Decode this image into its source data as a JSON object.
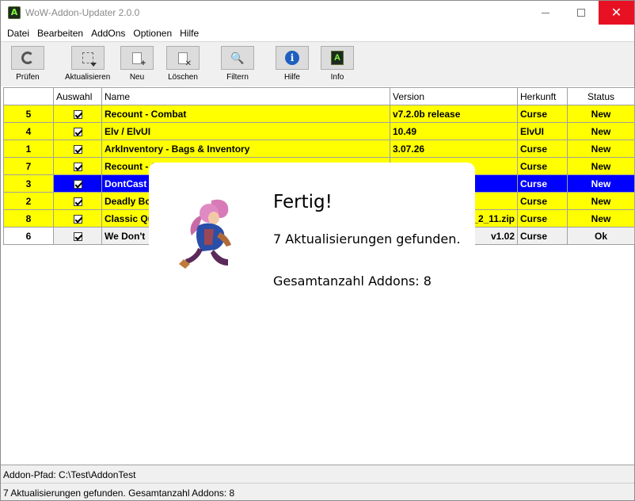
{
  "window": {
    "title": "WoW-Addon-Updater 2.0.0",
    "icon_letter": "A",
    "close_glyph": "✕"
  },
  "menu": [
    "Datei",
    "Bearbeiten",
    "AddOns",
    "Optionen",
    "Hilfe"
  ],
  "toolbar": {
    "check": "Prüfen",
    "update": "Aktualisieren",
    "new": "Neu",
    "delete": "Löschen",
    "filter": "Filtern",
    "help": "Hilfe",
    "info": "Info"
  },
  "grid": {
    "headers": [
      "",
      "Auswahl",
      "Name",
      "Version",
      "Herkunft",
      "Status"
    ],
    "rows": [
      {
        "num": "5",
        "name": "Recount - Combat",
        "version": "v7.2.0b release",
        "origin": "Curse",
        "status": "New"
      },
      {
        "num": "4",
        "name": "Elv / ElvUI",
        "version": "10.49",
        "origin": "ElvUI",
        "status": "New"
      },
      {
        "num": "1",
        "name": "ArkInventory - Bags & Inventory",
        "version": "3.07.26",
        "origin": "Curse",
        "status": "New"
      },
      {
        "num": "7",
        "name": "Recount - Co",
        "version": "",
        "origin": "Curse",
        "status": "New"
      },
      {
        "num": "3",
        "name": "DontCast -",
        "version": "",
        "origin": "Curse",
        "status": "New"
      },
      {
        "num": "2",
        "name": "Deadly Bo",
        "version": "",
        "origin": "Curse",
        "status": "New"
      },
      {
        "num": "8",
        "name": "Classic Qu",
        "version": "_2_11.zip",
        "origin": "Curse",
        "status": "New"
      },
      {
        "num": "6",
        "name": "We Don't",
        "version": "v1.02",
        "origin": "Curse",
        "status": "Ok"
      }
    ]
  },
  "toast": {
    "title": "Fertig!",
    "line1": "7 Aktualisierungen gefunden.",
    "line2": "Gesamtanzahl Addons: 8"
  },
  "path_bar": "Addon-Pfad: C:\\Test\\AddonTest",
  "status_bar": "7 Aktualisierungen gefunden. Gesamtanzahl Addons: 8"
}
